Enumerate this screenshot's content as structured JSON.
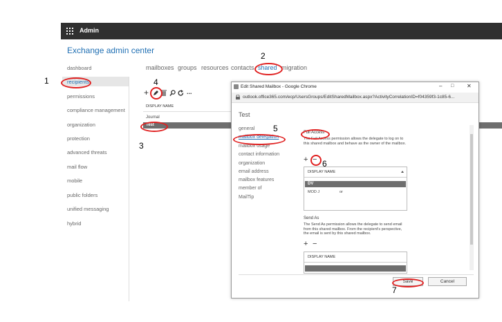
{
  "topbar": {
    "title": "Admin"
  },
  "eac": {
    "title": "Exchange admin center"
  },
  "nav": {
    "items": [
      "dashboard",
      "recipients",
      "permissions",
      "compliance management",
      "organization",
      "protection",
      "advanced threats",
      "mail flow",
      "mobile",
      "public folders",
      "unified messaging",
      "hybrid"
    ],
    "active": "recipients"
  },
  "tabs": [
    "mailboxes",
    "groups",
    "resources",
    "contacts",
    "shared",
    "migration"
  ],
  "toolbar": {
    "add": "+",
    "more": "..."
  },
  "list": {
    "column_header": "DISPLAY NAME",
    "rows": [
      "Journal",
      "Test"
    ]
  },
  "markers": [
    "1",
    "2",
    "3",
    "4",
    "5",
    "6",
    "7"
  ],
  "dialog": {
    "window_title": "Edit Shared Mailbox - Google Chrome",
    "url": "outlook.office365.com/ecp/UsersGroups/EditSharedMailbox.aspx?ActivityCorrelationID=f04359f3-1c85-6...",
    "heading": "Test",
    "nav": [
      "general",
      "mailbox delegation",
      "mailbox usage",
      "contact information",
      "organization",
      "email address",
      "mailbox features",
      "member of",
      "MailTip"
    ],
    "full_access": {
      "title": "Full Access",
      "description": "The Full Access permission allows the delegate to log on to this shared mailbox and behave as the owner of the mailbox.",
      "column_header": "DISPLAY NAME",
      "rows": [
        "DV",
        "MOD J",
        "or"
      ]
    },
    "send_as": {
      "title": "Send As",
      "description": "The Send As permission allows the delegate to send email from this shared mailbox. From the recipient's perspective, the email is sent by this shared mailbox.",
      "column_header": "DISPLAY NAME"
    },
    "buttons": {
      "save": "Save",
      "cancel": "Cancel"
    }
  },
  "colors": {
    "accent": "#1f6fb3",
    "topbar": "#303030",
    "annotation": "#e02020",
    "selected_row": "#6e6e6e"
  }
}
